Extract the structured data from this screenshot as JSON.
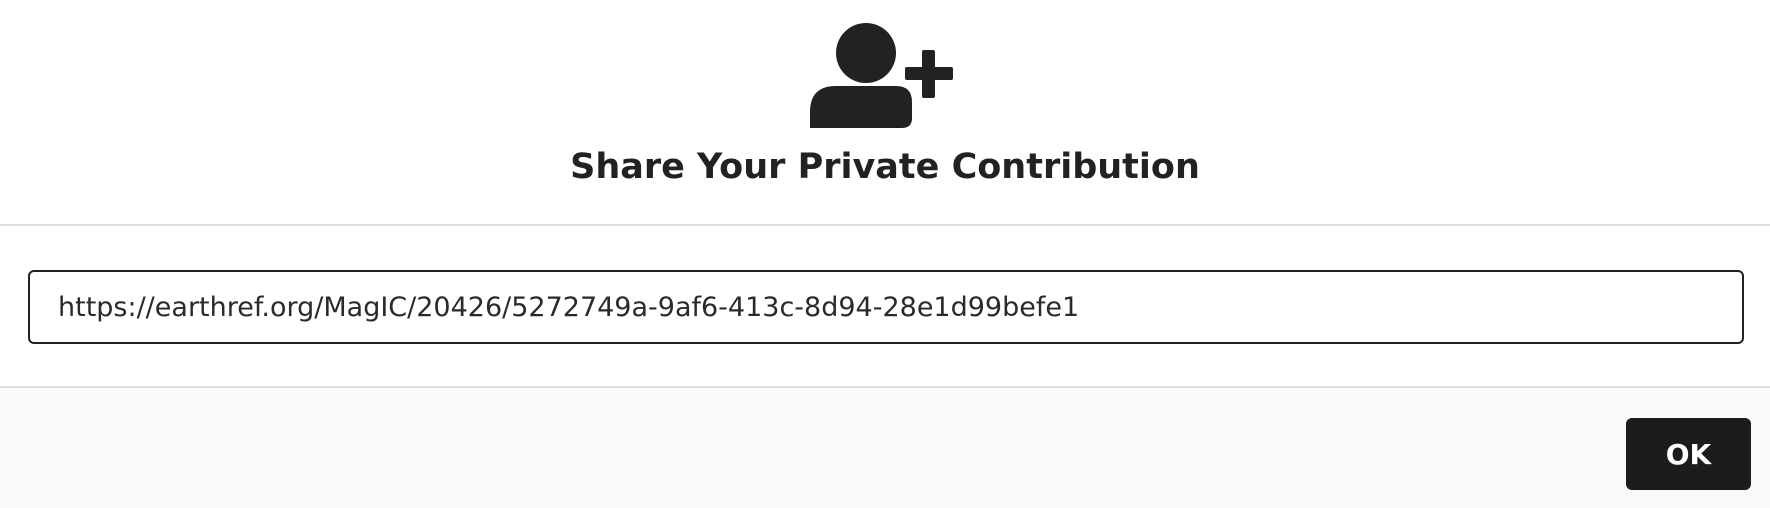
{
  "dialog": {
    "icon": "user-plus-icon",
    "title": "Share Your Private Contribution",
    "share_url": "https://earthref.org/MagIC/20426/5272749a-9af6-413c-8d94-28e1d99befe1",
    "ok_label": "OK"
  },
  "colors": {
    "text": "#222222",
    "button_bg": "#1c1c1c",
    "button_text": "#ffffff",
    "divider": "#dedede",
    "actions_bg": "#f9f9f9"
  }
}
